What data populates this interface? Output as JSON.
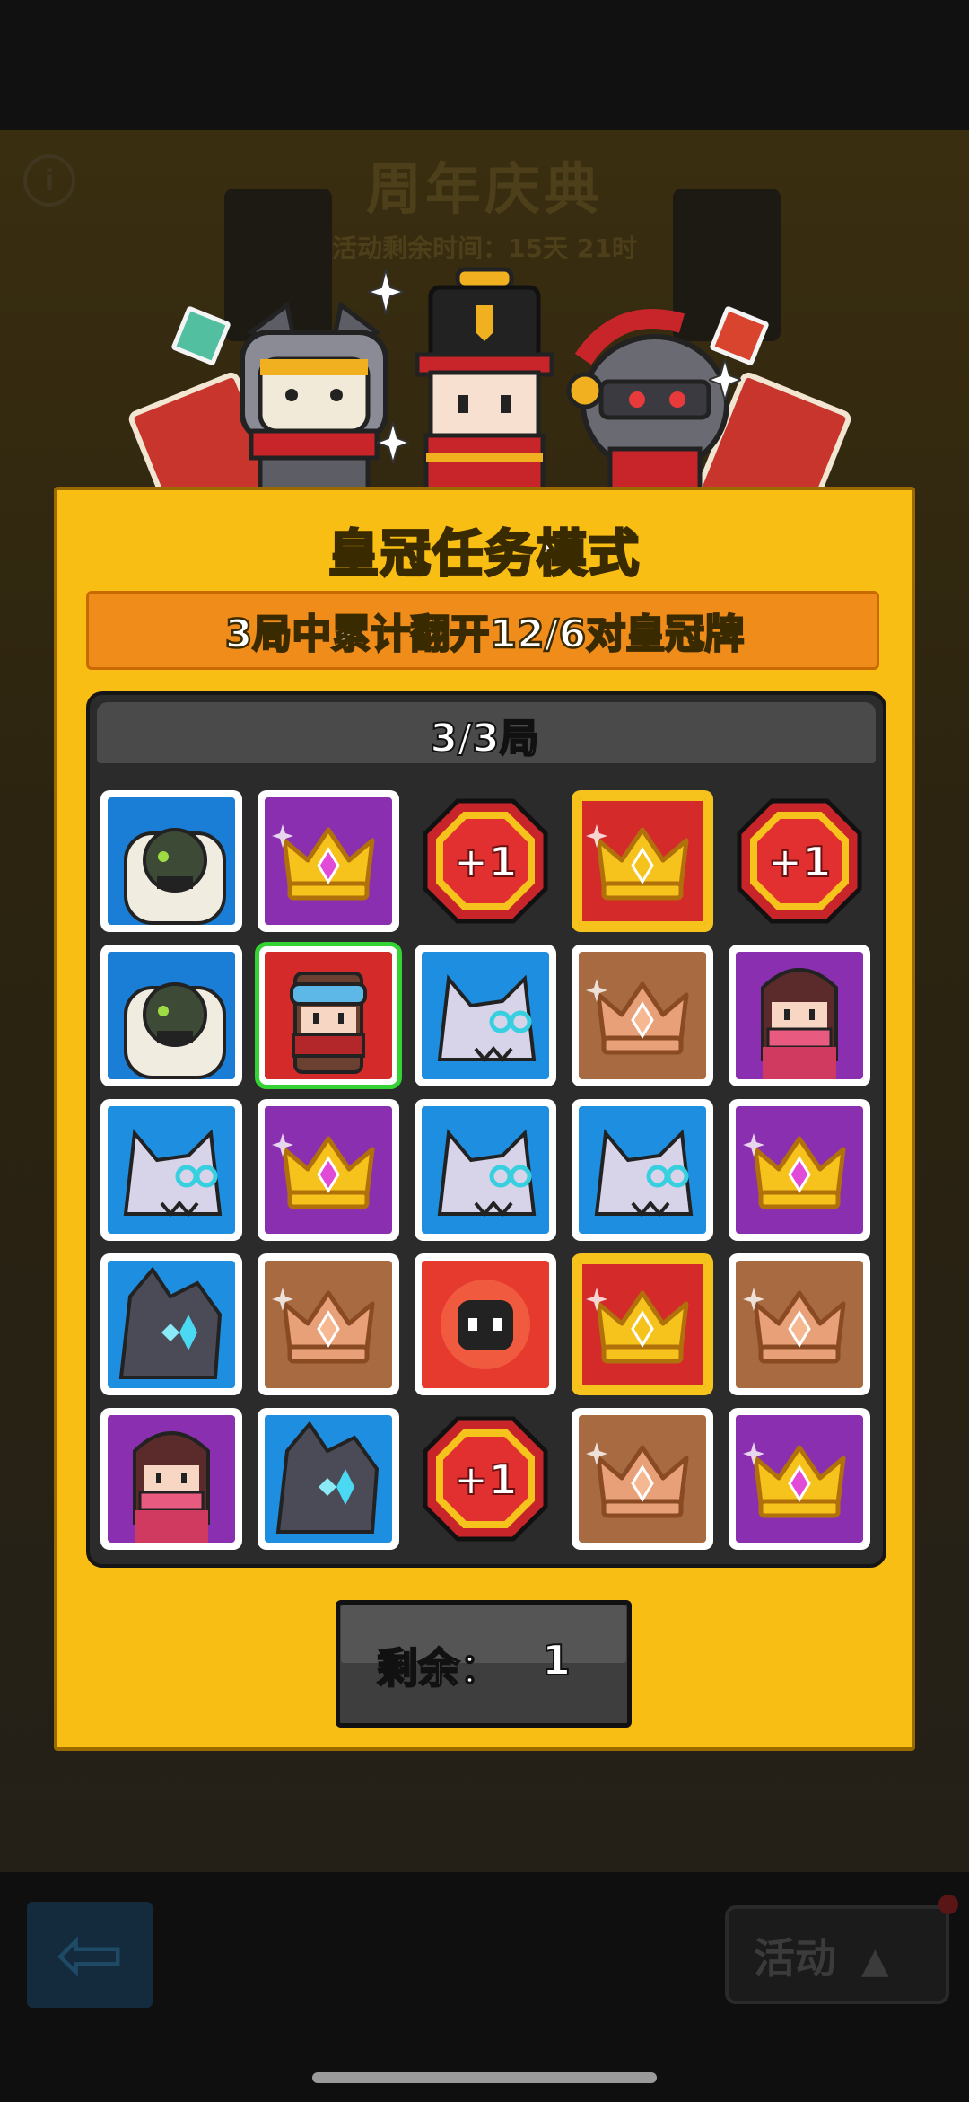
{
  "background": {
    "event_title": "周年庆典",
    "event_timer": "活动剩余时间：15天 21时",
    "info_icon": "info-icon",
    "back_icon": "back-arrow-icon",
    "activity_label": "活动",
    "activity_icon": "triangle-up-icon"
  },
  "panel": {
    "title": "皇冠任务模式",
    "task": "3局中累计翻开12/6对皇冠牌",
    "round": "3/3局",
    "remaining_label": "剩余：",
    "remaining_value": "1"
  },
  "colors": {
    "panel_yellow": "#f9be13",
    "banner_orange": "#f08c1a",
    "selected_green": "#35d234",
    "tile_blue": "#1e8ee0",
    "tile_purple": "#8a2fb0",
    "tile_red": "#d42a2a",
    "tile_bronze": "#a86a40"
  },
  "grid": [
    [
      "robot-card",
      "gold-crown-purple",
      "plus-one-card",
      "gold-crown-red",
      "plus-one-card"
    ],
    [
      "robot-card",
      "red-ninja-card-selected",
      "wolf-card",
      "bronze-crown",
      "pink-ninja-card"
    ],
    [
      "wolf-card",
      "gold-crown-purple",
      "wolf-card",
      "wolf-card",
      "gold-crown-purple"
    ],
    [
      "dark-dragon-card",
      "bronze-crown",
      "bomb-card",
      "gold-crown-red",
      "bronze-crown"
    ],
    [
      "pink-ninja-card",
      "dark-dragon-card",
      "plus-one-card",
      "bronze-crown",
      "gold-crown-purple"
    ]
  ],
  "plus_one_text": "+1"
}
